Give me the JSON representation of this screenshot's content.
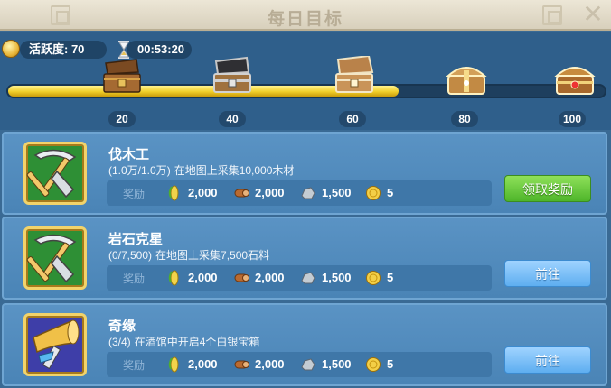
{
  "header": {
    "title": "每日目标",
    "close_icon": "close-icon"
  },
  "activity": {
    "label": "活跃度: 70",
    "timer": "00:53:20",
    "progress": 0.655
  },
  "milestones": [
    {
      "value": "20",
      "icon": "wooden-chest-open-icon"
    },
    {
      "value": "40",
      "icon": "iron-chest-open-icon"
    },
    {
      "value": "60",
      "icon": "silver-chest-open-icon"
    },
    {
      "value": "80",
      "icon": "golden-chest-icon"
    },
    {
      "value": "100",
      "icon": "royal-chest-icon"
    }
  ],
  "tasks": [
    {
      "title": "伐木工",
      "progress": "(1.0万/1.0万)",
      "description": "在地图上采集10,000木材",
      "icon": "pickaxe-shovel-icon",
      "reward_label": "奖励",
      "rewards": {
        "food": "2,000",
        "wood": "2,000",
        "stone": "1,500",
        "gold": "5"
      },
      "button": {
        "label": "领取奖励",
        "type": "claim"
      }
    },
    {
      "title": "岩石克星",
      "progress": "(0/7,500)",
      "description": "在地图上采集7,500石料",
      "icon": "pickaxe-shovel-icon",
      "reward_label": "奖励",
      "rewards": {
        "food": "2,000",
        "wood": "2,000",
        "stone": "1,500",
        "gold": "5"
      },
      "button": {
        "label": "前往",
        "type": "goto"
      }
    },
    {
      "title": "奇缘",
      "progress": "(3/4)",
      "description": "在酒馆中开启4个白银宝箱",
      "icon": "horn-hammer-icon",
      "reward_label": "奖励",
      "rewards": {
        "food": "2,000",
        "wood": "2,000",
        "stone": "1,500",
        "gold": "5"
      },
      "button": {
        "label": "前往",
        "type": "goto"
      }
    }
  ],
  "colors": {
    "claim_button": "#5cc136",
    "goto_button": "#6ab6f4",
    "progress_fill": "#f0cf2a"
  }
}
